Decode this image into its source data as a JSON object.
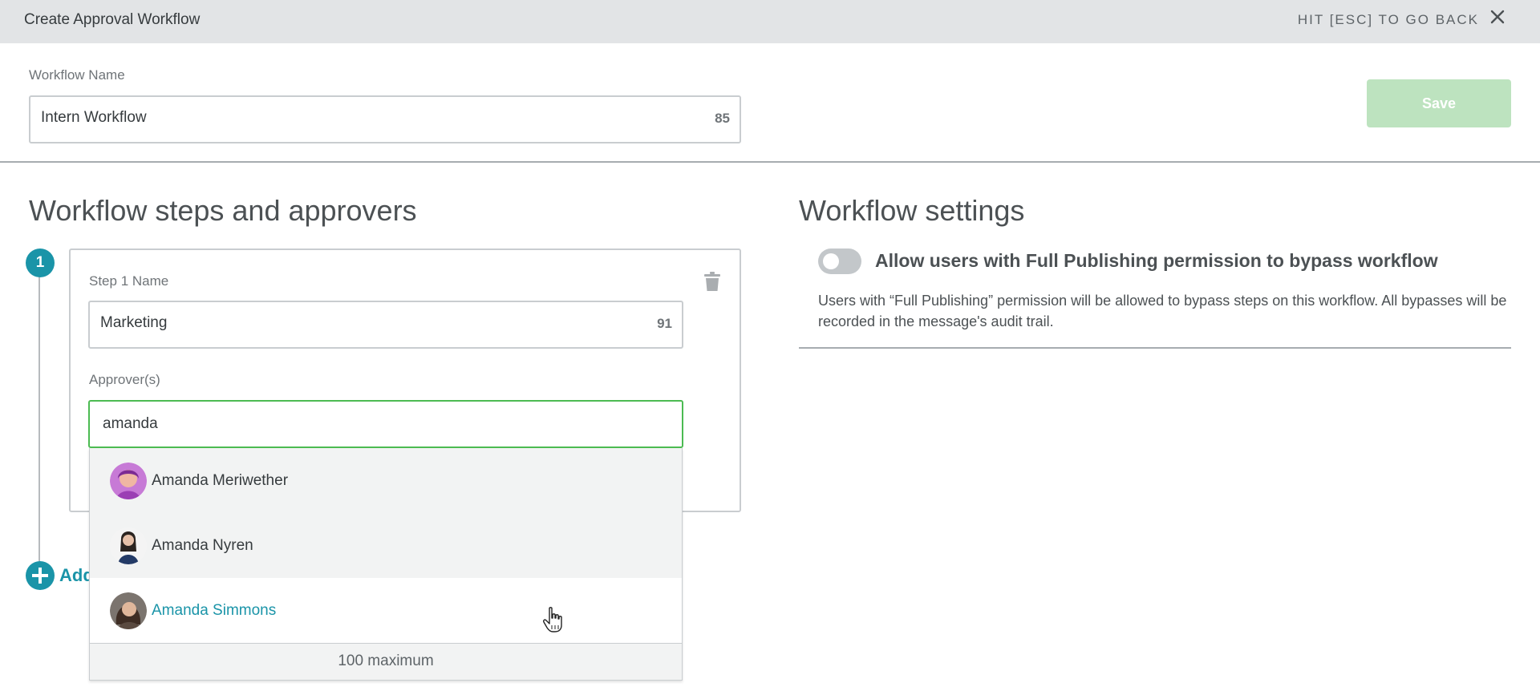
{
  "header": {
    "title": "Create Approval Workflow",
    "esc_hint": "HIT [ESC] TO GO BACK",
    "close_icon": "close-icon"
  },
  "workflow_name": {
    "label": "Workflow Name",
    "value": "Intern Workflow",
    "remaining": "85"
  },
  "save_button": {
    "label": "Save",
    "color": "#bde3bf"
  },
  "steps_section": {
    "title": "Workflow steps and approvers",
    "steps": [
      {
        "number": "1",
        "name_label": "Step 1 Name",
        "name_value": "Marketing",
        "remaining": "91",
        "approvers_label": "Approver(s)",
        "approver_query": "amanda"
      }
    ],
    "add_step_label": "Add"
  },
  "approver_dropdown": {
    "options": [
      {
        "name": "Amanda Meriwether",
        "avatar": "avatar-purple"
      },
      {
        "name": "Amanda Nyren",
        "avatar": "avatar-portrait"
      },
      {
        "name": "Amanda Simmons",
        "avatar": "avatar-portrait-smile"
      }
    ],
    "hovered_index": 2,
    "footer": "100 maximum"
  },
  "settings_section": {
    "title": "Workflow settings",
    "bypass_toggle": {
      "label": "Allow users with Full Publishing permission to bypass workflow",
      "on": false,
      "description": "Users with “Full Publishing” permission will be allowed to bypass steps on this workflow. All bypasses will be recorded in the message's audit trail."
    }
  },
  "colors": {
    "accent": "#1a94a8",
    "focus_green": "#4cbb52",
    "header_bg": "#e2e4e6"
  }
}
